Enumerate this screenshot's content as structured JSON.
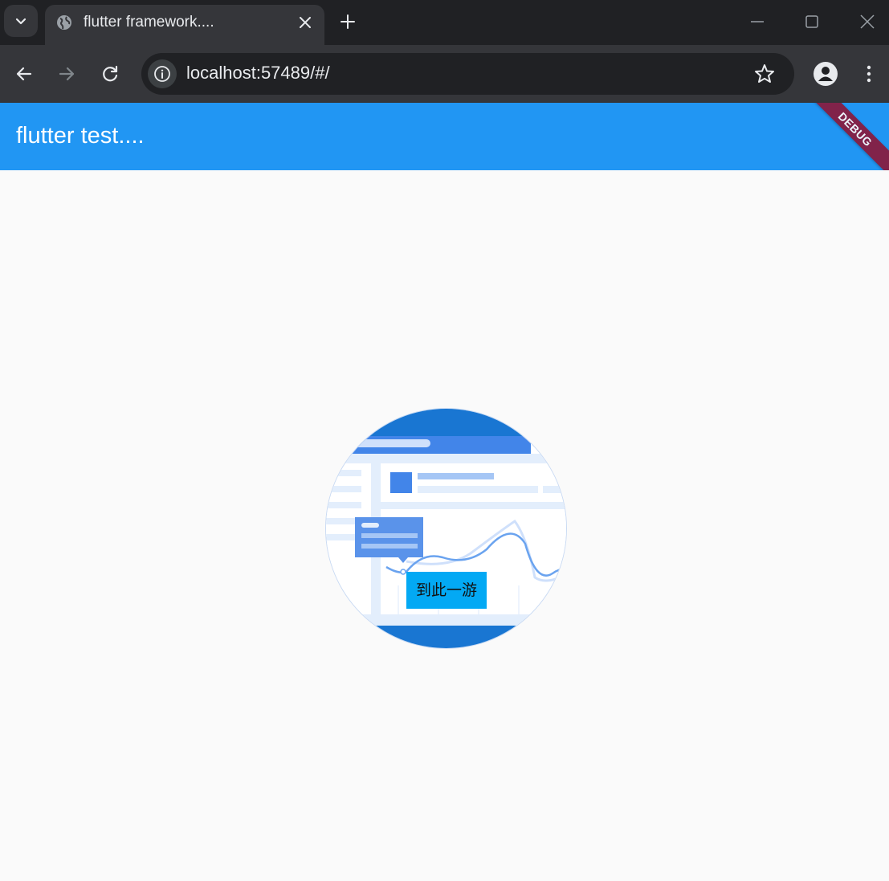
{
  "browser": {
    "tab": {
      "title": "flutter framework...."
    },
    "address_bar": {
      "url": "localhost:57489/#/"
    }
  },
  "app": {
    "appbar": {
      "title": "flutter test...."
    },
    "debug_banner": "DEBUG",
    "tour_button": {
      "label": "到此一游"
    }
  },
  "colors": {
    "appbar": "#2196f3",
    "tour_button": "#03a9f4",
    "debug_banner": "#8a1a3c",
    "chrome_dark": "#202124",
    "chrome_toolbar": "#35363a"
  },
  "icons": {
    "tab_search": "chevron-down-icon",
    "favicon": "globe-icon",
    "tab_close": "close-icon",
    "new_tab": "plus-icon",
    "minimize": "minimize-icon",
    "maximize": "maximize-icon",
    "close_window": "close-icon",
    "back": "arrow-left-icon",
    "forward": "arrow-right-icon",
    "reload": "reload-icon",
    "site_info": "info-icon",
    "bookmark": "star-icon",
    "profile": "account-icon",
    "menu": "more-vert-icon"
  }
}
